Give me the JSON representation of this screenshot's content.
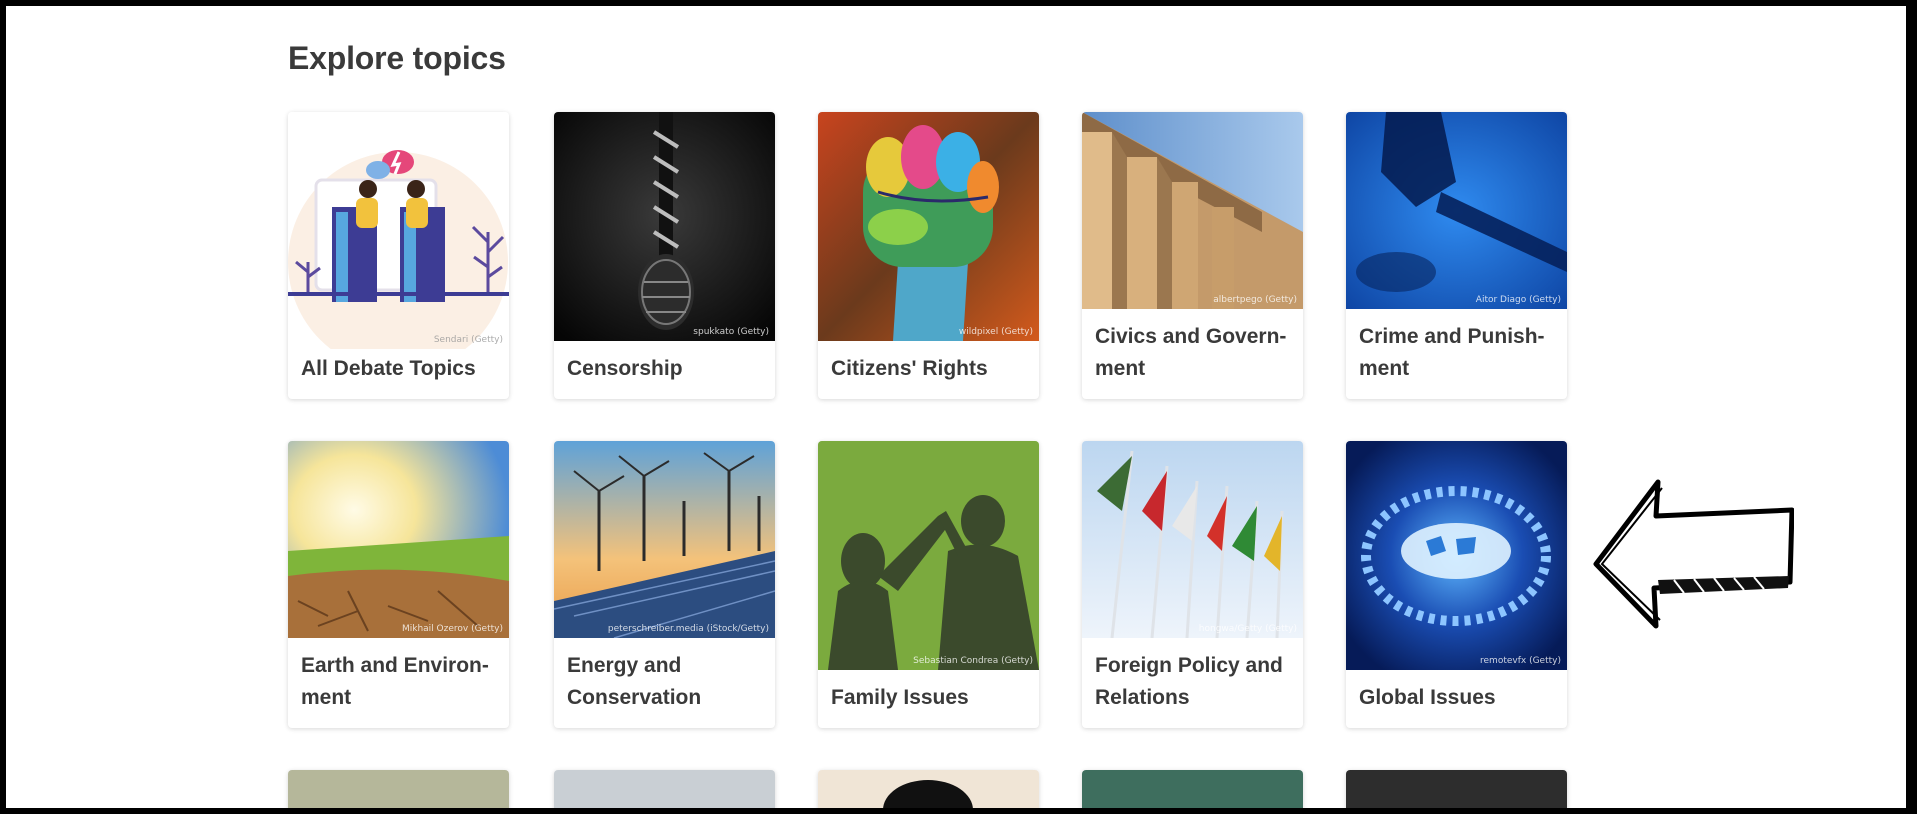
{
  "page": {
    "heading": "Explore topics"
  },
  "topics": [
    {
      "label": "All Debate Topics",
      "credit": "Sendari (Getty)"
    },
    {
      "label": "Censorship",
      "credit": "spukkato (Getty)"
    },
    {
      "label": "Citizens' Rights",
      "credit": "wildpixel (Getty)"
    },
    {
      "label": "Civics and Govern-ment",
      "credit": "albertpego (Getty)"
    },
    {
      "label": "Crime and Punish-ment",
      "credit": "Aitor Diago (Getty)"
    },
    {
      "label": "Earth and Environ-ment",
      "credit": "Mikhail Ozerov (Getty)"
    },
    {
      "label": "Energy and Conservation",
      "credit": "peterschreiber.media (iStock/Getty)"
    },
    {
      "label": "Family Issues",
      "credit": "Sebastian Condrea (Getty)"
    },
    {
      "label": "Foreign Policy and Relations",
      "credit": "hongwa/Getty (Getty)"
    },
    {
      "label": "Global Issues",
      "credit": "remotevfx (Getty)"
    }
  ],
  "annotation": {
    "icon": "hand-drawn-arrow-icon",
    "points_to": "Global Issues"
  }
}
